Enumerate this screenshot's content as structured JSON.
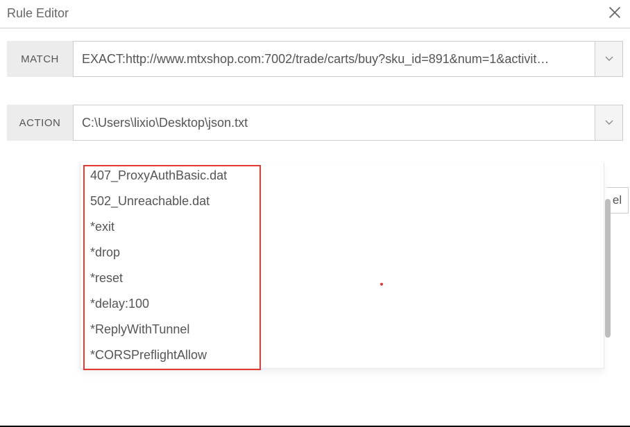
{
  "header": {
    "title": "Rule Editor"
  },
  "match": {
    "label": "MATCH",
    "value": "EXACT:http://www.mtxshop.com:7002/trade/carts/buy?sku_id=891&num=1&activit…"
  },
  "action": {
    "label": "ACTION",
    "value": "C:\\Users\\lixio\\Desktop\\json.txt"
  },
  "dropdown_items": [
    "407_ProxyAuthBasic.dat",
    "502_Unreachable.dat",
    "*exit",
    "*drop",
    "*reset",
    "*delay:100",
    "*ReplyWithTunnel",
    "*CORSPreflightAllow"
  ],
  "partial_button": "el"
}
